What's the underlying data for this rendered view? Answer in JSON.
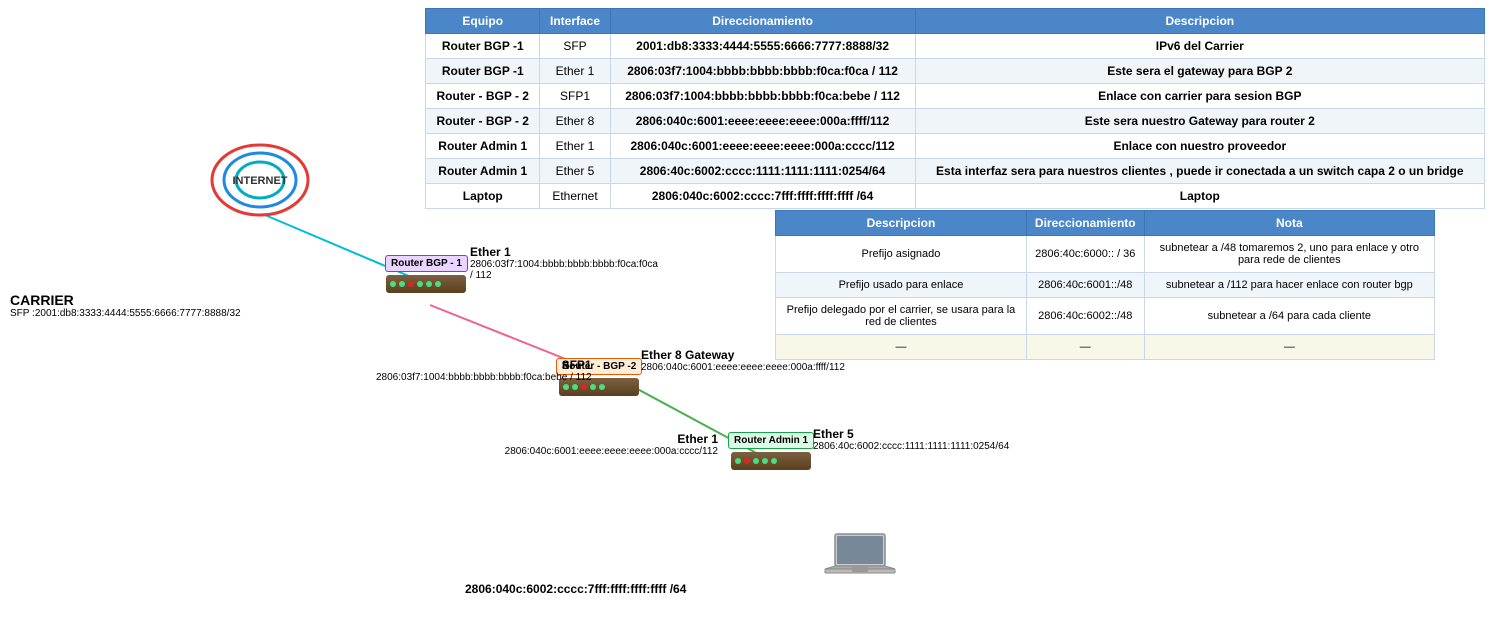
{
  "table": {
    "headers": [
      "Equipo",
      "Interface",
      "Direccionamiento",
      "Descripcion"
    ],
    "rows": [
      [
        "Router BGP -1",
        "SFP",
        "2001:db8:3333:4444:5555:6666:7777:8888/32",
        "IPv6 del Carrier"
      ],
      [
        "Router BGP -1",
        "Ether 1",
        "2806:03f7:1004:bbbb:bbbb:bbbb:f0ca:f0ca / 112",
        "Este sera el gateway para BGP 2"
      ],
      [
        "Router - BGP - 2",
        "SFP1",
        "2806:03f7:1004:bbbb:bbbb:bbbb:f0ca:bebe / 112",
        "Enlace con carrier para sesion BGP"
      ],
      [
        "Router - BGP - 2",
        "Ether 8",
        "2806:040c:6001:eeee:eeee:eeee:000a:ffff/112",
        "Este sera nuestro Gateway para router 2"
      ],
      [
        "Router Admin 1",
        "Ether 1",
        "2806:040c:6001:eeee:eeee:eeee:000a:cccc/112",
        "Enlace con nuestro proveedor"
      ],
      [
        "Router Admin 1",
        "Ether 5",
        "2806:40c:6002:cccc:1111:1111:1111:0254/64",
        "Esta interfaz sera para nuestros clientes , puede ir conectada a un switch capa 2 o un bridge"
      ],
      [
        "Laptop",
        "Ethernet",
        "2806:040c:6002:cccc:7fff:ffff:ffff:ffff /64",
        "Laptop"
      ]
    ]
  },
  "second_table": {
    "headers": [
      "Descripcion",
      "Direccionamiento",
      "Nota"
    ],
    "rows": [
      [
        "Prefijo asignado",
        "2806:40c:6000:: / 36",
        "subnetear a /48  tomaremos 2, uno para enlace y otro para rede de clientes"
      ],
      [
        "Prefijo usado para enlace",
        "2806:40c:6001::/48",
        "subnetear a /112 para hacer enlace con router bgp"
      ],
      [
        "Prefijo delegado por el carrier, se usara para la red de clientes",
        "2806:40c:6002::/48",
        "subnetear a /64 para cada cliente"
      ],
      [
        "—",
        "—",
        "—"
      ]
    ]
  },
  "diagram": {
    "internet_label": "INTERNET",
    "carrier_label": "CARRIER",
    "carrier_ip": "SFP :2001:db8:3333:4444:5555:6666:7777:8888/32",
    "router_bgp1_label": "Router BGP -\n1",
    "router_bgp2_label": "Router - BGP -2",
    "router_admin1_label": "Router Admin 1",
    "ether1_label": "Ether 1",
    "ether1_ip": "2806:03f7:1004:bbbb:bbbb:bbbb:f0ca:f0ca / 112",
    "sfp1_label": "SFP1",
    "sfp1_ip": "2806:03f7:1004:bbbb:bbbb:bbbb:f0ca:bebe / 112",
    "ether8_label": "Ether 8 Gateway",
    "ether8_ip": "2806:040c:6001:eeee:eeee:eeee:000a:ffff/112",
    "ether1_admin_label": "Ether 1",
    "ether1_admin_ip": "2806:040c:6001:eeee:eeee:eeee:000a:cccc/112",
    "ether5_label": "Ether 5",
    "ether5_ip": "2806:40c:6002:cccc:1111:1111:1111:0254/64",
    "laptop_ip": "2806:040c:6002:cccc:7fff:ffff:ffff:ffff /64"
  }
}
